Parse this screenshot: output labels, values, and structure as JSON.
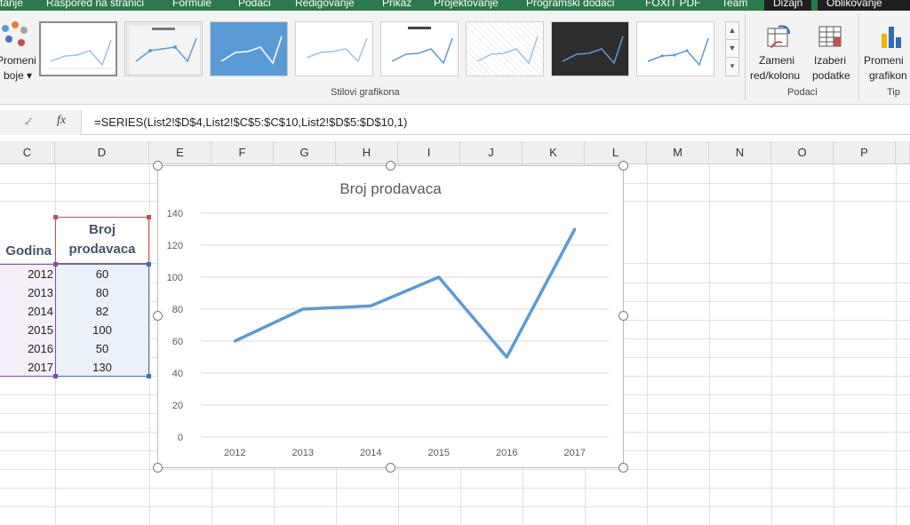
{
  "tabs": [
    {
      "id": "tab-0",
      "label": "tanje"
    },
    {
      "id": "tab-1",
      "label": "Raspored na stranici"
    },
    {
      "id": "tab-2",
      "label": "Formule"
    },
    {
      "id": "tab-3",
      "label": "Podaci"
    },
    {
      "id": "tab-4",
      "label": "Redigovanje"
    },
    {
      "id": "tab-5",
      "label": "Prikaz"
    },
    {
      "id": "tab-6",
      "label": "Projektovanje"
    },
    {
      "id": "tab-7",
      "label": "Programski dodaci"
    },
    {
      "id": "tab-8",
      "label": "FOXIT PDF"
    },
    {
      "id": "tab-9",
      "label": "Team"
    },
    {
      "id": "tab-10",
      "label": "Dizajn"
    },
    {
      "id": "tab-11",
      "label": "Oblikovanje"
    }
  ],
  "ribbon": {
    "change_colors": {
      "line1": "Promeni",
      "line2": "boje ▾"
    },
    "chart_styles_label": "Stilovi grafikona",
    "switch_rowcol": {
      "line1": "Zameni",
      "line2": "red/kolonu"
    },
    "select_data": {
      "line1": "Izaberi",
      "line2": "podatke"
    },
    "data_group_label": "Podaci",
    "change_chart": {
      "line1": "Promeni",
      "line2": "grafikon"
    },
    "type_group_label": "Tip"
  },
  "formula_bar": {
    "check_symbol": "✓",
    "fx_label": "fx",
    "formula": "=SERIES(List2!$D$4,List2!$C$5:$C$10,List2!$D$5:$D$10,1)"
  },
  "columns": [
    "C",
    "D",
    "E",
    "F",
    "G",
    "H",
    "I",
    "J",
    "K",
    "L",
    "M",
    "N",
    "O",
    "P"
  ],
  "table": {
    "col_year_header": "Godina",
    "col_sellers_header_line1": "Broj",
    "col_sellers_header_line2": "prodavaca",
    "rows": [
      {
        "year": "2012",
        "value": "60"
      },
      {
        "year": "2013",
        "value": "80"
      },
      {
        "year": "2014",
        "value": "82"
      },
      {
        "year": "2015",
        "value": "100"
      },
      {
        "year": "2016",
        "value": "50"
      },
      {
        "year": "2017",
        "value": "130"
      }
    ]
  },
  "chart_data": {
    "type": "line",
    "title": "Broj prodavaca",
    "categories": [
      "2012",
      "2013",
      "2014",
      "2015",
      "2016",
      "2017"
    ],
    "series": [
      {
        "values": [
          60,
          80,
          82,
          100,
          50,
          130
        ]
      }
    ],
    "ylim": [
      0,
      140
    ],
    "yticks": [
      "0",
      "20",
      "40",
      "60",
      "80",
      "100",
      "120",
      "140"
    ],
    "grid": true,
    "legend": "none",
    "line_color": "#5b9bd5",
    "grid_color": "#d9d9d9"
  },
  "colors": {
    "tabbar": "#2b7a4b",
    "selection_blue": "#3d6fb5",
    "selection_red": "#c0504d",
    "selection_purple": "#7b4fa6"
  }
}
